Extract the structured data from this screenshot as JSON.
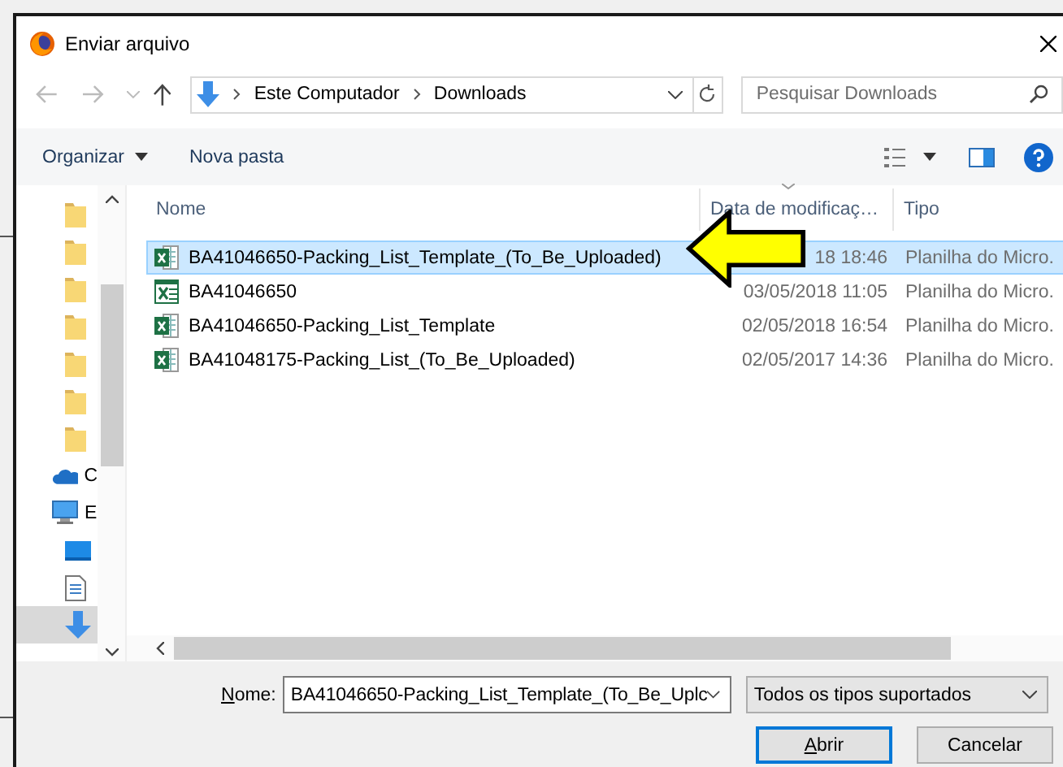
{
  "window": {
    "title": "Enviar arquivo"
  },
  "address": {
    "segments": [
      "Este Computador",
      "Downloads"
    ]
  },
  "search": {
    "placeholder": "Pesquisar Downloads"
  },
  "toolbar": {
    "buttons": [
      {
        "label": "Organizar",
        "kind": "menu"
      },
      {
        "label": "Nova pasta",
        "kind": "plain"
      }
    ]
  },
  "sidebar": {
    "items": [
      {
        "kind": "folder",
        "selected": false
      },
      {
        "kind": "folder",
        "selected": false
      },
      {
        "kind": "folder",
        "selected": false
      },
      {
        "kind": "folder",
        "selected": false
      },
      {
        "kind": "folder",
        "selected": false
      },
      {
        "kind": "folder",
        "selected": false
      },
      {
        "kind": "folder",
        "selected": false
      },
      {
        "kind": "cloud",
        "label": "C",
        "selected": false
      },
      {
        "kind": "computer",
        "label": "E",
        "selected": false
      },
      {
        "kind": "desktop",
        "selected": false
      },
      {
        "kind": "document",
        "selected": false
      },
      {
        "kind": "download",
        "selected": true
      }
    ]
  },
  "table": {
    "columns": [
      "Nome",
      "Data de modificaç…",
      "Tipo"
    ],
    "rows": [
      {
        "kind": "xlsx",
        "name": "BA41046650-Packing_List_Template_(To_Be_Uploaded)",
        "date": "18 18:46",
        "type": "Planilha do Micro.",
        "selected": true
      },
      {
        "kind": "xls",
        "name": "BA41046650",
        "date": "03/05/2018 11:05",
        "type": "Planilha do Micro.",
        "selected": false
      },
      {
        "kind": "xlsx",
        "name": "BA41046650-Packing_List_Template",
        "date": "02/05/2018 16:54",
        "type": "Planilha do Micro.",
        "selected": false
      },
      {
        "kind": "xlsx",
        "name": "BA41048175-Packing_List_(To_Be_Uploaded)",
        "date": "02/05/2017 14:36",
        "type": "Planilha do Micro.",
        "selected": false
      }
    ]
  },
  "footer": {
    "name_label": "Nome:",
    "file_name": "BA41046650-Packing_List_Template_(To_Be_Uplc",
    "filter": "Todos os tipos suportados",
    "buttons": [
      {
        "label": "Abrir",
        "default": true
      },
      {
        "label": "Cancelar",
        "default": false
      }
    ]
  }
}
